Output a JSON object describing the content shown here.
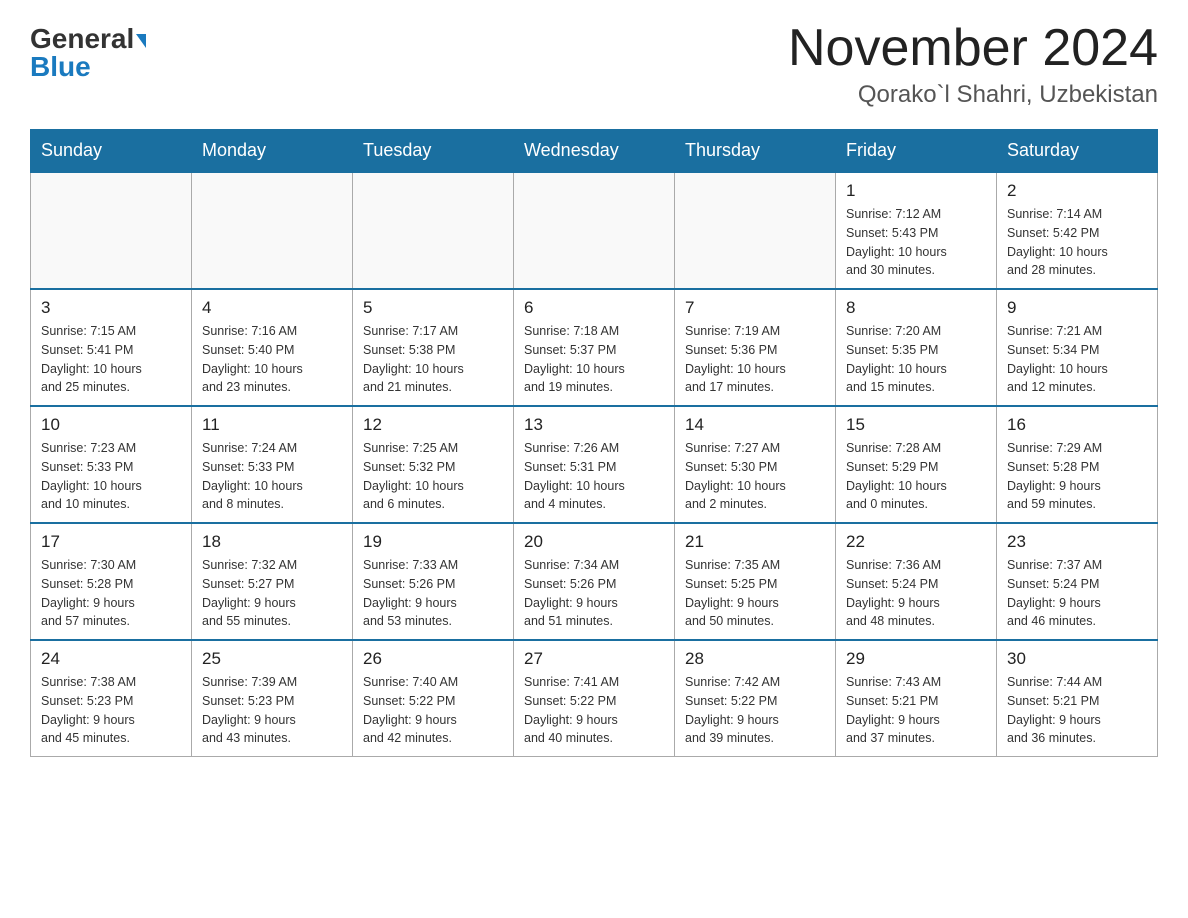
{
  "header": {
    "logo_general": "General",
    "logo_blue": "Blue",
    "title": "November 2024",
    "subtitle": "Qorako`l Shahri, Uzbekistan"
  },
  "weekdays": [
    "Sunday",
    "Monday",
    "Tuesday",
    "Wednesday",
    "Thursday",
    "Friday",
    "Saturday"
  ],
  "weeks": [
    [
      {
        "day": "",
        "info": ""
      },
      {
        "day": "",
        "info": ""
      },
      {
        "day": "",
        "info": ""
      },
      {
        "day": "",
        "info": ""
      },
      {
        "day": "",
        "info": ""
      },
      {
        "day": "1",
        "info": "Sunrise: 7:12 AM\nSunset: 5:43 PM\nDaylight: 10 hours\nand 30 minutes."
      },
      {
        "day": "2",
        "info": "Sunrise: 7:14 AM\nSunset: 5:42 PM\nDaylight: 10 hours\nand 28 minutes."
      }
    ],
    [
      {
        "day": "3",
        "info": "Sunrise: 7:15 AM\nSunset: 5:41 PM\nDaylight: 10 hours\nand 25 minutes."
      },
      {
        "day": "4",
        "info": "Sunrise: 7:16 AM\nSunset: 5:40 PM\nDaylight: 10 hours\nand 23 minutes."
      },
      {
        "day": "5",
        "info": "Sunrise: 7:17 AM\nSunset: 5:38 PM\nDaylight: 10 hours\nand 21 minutes."
      },
      {
        "day": "6",
        "info": "Sunrise: 7:18 AM\nSunset: 5:37 PM\nDaylight: 10 hours\nand 19 minutes."
      },
      {
        "day": "7",
        "info": "Sunrise: 7:19 AM\nSunset: 5:36 PM\nDaylight: 10 hours\nand 17 minutes."
      },
      {
        "day": "8",
        "info": "Sunrise: 7:20 AM\nSunset: 5:35 PM\nDaylight: 10 hours\nand 15 minutes."
      },
      {
        "day": "9",
        "info": "Sunrise: 7:21 AM\nSunset: 5:34 PM\nDaylight: 10 hours\nand 12 minutes."
      }
    ],
    [
      {
        "day": "10",
        "info": "Sunrise: 7:23 AM\nSunset: 5:33 PM\nDaylight: 10 hours\nand 10 minutes."
      },
      {
        "day": "11",
        "info": "Sunrise: 7:24 AM\nSunset: 5:33 PM\nDaylight: 10 hours\nand 8 minutes."
      },
      {
        "day": "12",
        "info": "Sunrise: 7:25 AM\nSunset: 5:32 PM\nDaylight: 10 hours\nand 6 minutes."
      },
      {
        "day": "13",
        "info": "Sunrise: 7:26 AM\nSunset: 5:31 PM\nDaylight: 10 hours\nand 4 minutes."
      },
      {
        "day": "14",
        "info": "Sunrise: 7:27 AM\nSunset: 5:30 PM\nDaylight: 10 hours\nand 2 minutes."
      },
      {
        "day": "15",
        "info": "Sunrise: 7:28 AM\nSunset: 5:29 PM\nDaylight: 10 hours\nand 0 minutes."
      },
      {
        "day": "16",
        "info": "Sunrise: 7:29 AM\nSunset: 5:28 PM\nDaylight: 9 hours\nand 59 minutes."
      }
    ],
    [
      {
        "day": "17",
        "info": "Sunrise: 7:30 AM\nSunset: 5:28 PM\nDaylight: 9 hours\nand 57 minutes."
      },
      {
        "day": "18",
        "info": "Sunrise: 7:32 AM\nSunset: 5:27 PM\nDaylight: 9 hours\nand 55 minutes."
      },
      {
        "day": "19",
        "info": "Sunrise: 7:33 AM\nSunset: 5:26 PM\nDaylight: 9 hours\nand 53 minutes."
      },
      {
        "day": "20",
        "info": "Sunrise: 7:34 AM\nSunset: 5:26 PM\nDaylight: 9 hours\nand 51 minutes."
      },
      {
        "day": "21",
        "info": "Sunrise: 7:35 AM\nSunset: 5:25 PM\nDaylight: 9 hours\nand 50 minutes."
      },
      {
        "day": "22",
        "info": "Sunrise: 7:36 AM\nSunset: 5:24 PM\nDaylight: 9 hours\nand 48 minutes."
      },
      {
        "day": "23",
        "info": "Sunrise: 7:37 AM\nSunset: 5:24 PM\nDaylight: 9 hours\nand 46 minutes."
      }
    ],
    [
      {
        "day": "24",
        "info": "Sunrise: 7:38 AM\nSunset: 5:23 PM\nDaylight: 9 hours\nand 45 minutes."
      },
      {
        "day": "25",
        "info": "Sunrise: 7:39 AM\nSunset: 5:23 PM\nDaylight: 9 hours\nand 43 minutes."
      },
      {
        "day": "26",
        "info": "Sunrise: 7:40 AM\nSunset: 5:22 PM\nDaylight: 9 hours\nand 42 minutes."
      },
      {
        "day": "27",
        "info": "Sunrise: 7:41 AM\nSunset: 5:22 PM\nDaylight: 9 hours\nand 40 minutes."
      },
      {
        "day": "28",
        "info": "Sunrise: 7:42 AM\nSunset: 5:22 PM\nDaylight: 9 hours\nand 39 minutes."
      },
      {
        "day": "29",
        "info": "Sunrise: 7:43 AM\nSunset: 5:21 PM\nDaylight: 9 hours\nand 37 minutes."
      },
      {
        "day": "30",
        "info": "Sunrise: 7:44 AM\nSunset: 5:21 PM\nDaylight: 9 hours\nand 36 minutes."
      }
    ]
  ]
}
